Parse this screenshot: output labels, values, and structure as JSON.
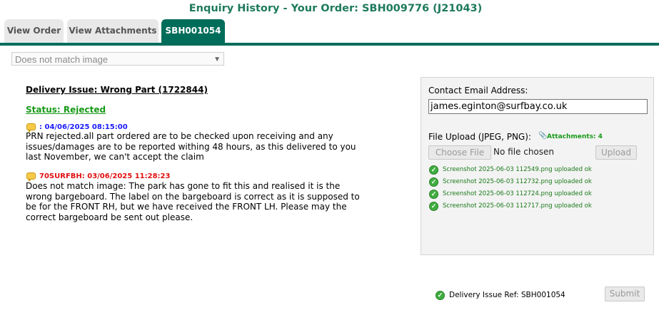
{
  "page": {
    "title": "Enquiry History - Your Order: SBH009776 (J21043)"
  },
  "tabs": [
    {
      "label": "View Order"
    },
    {
      "label": "View Attachments"
    },
    {
      "label": "SBH001054"
    }
  ],
  "reason_select": {
    "value": "Does not match image"
  },
  "issue": {
    "title": "Delivery Issue: Wrong Part (1722844)",
    "status": "Status: Rejected"
  },
  "messages": [
    {
      "header": ": 04/06/2025 08:15:00",
      "header_color": "#1a1aff",
      "body": "PRN rejected.all part ordered are to be checked upon receiving and any issues/damages are to be reported withing 48 hours, as this delivered to you last November, we can't accept the claim"
    },
    {
      "header": "70SURFBH: 03/06/2025 11:28:23",
      "header_color": "#e01010",
      "body": "Does not match image: The park has gone to fit this and realised it is the wrong bargeboard. The label on the bargeboard is correct as it is supposed to be for the FRONT RH, but we have received the FRONT LH. Please may the correct bargeboard be sent out please."
    }
  ],
  "contact": {
    "label": "Contact Email Address:",
    "email": "james.eginton@surfbay.co.uk"
  },
  "upload": {
    "label": "File Upload (JPEG, PNG):",
    "attachments": "Attachments: 4",
    "choose_label": "Choose File",
    "no_file": "No file chosen",
    "upload_label": "Upload",
    "uploaded": [
      "Screenshot 2025-06-03 112549.png uploaded ok",
      "Screenshot 2025-06-03 112732.png uploaded ok",
      "Screenshot 2025-06-03 112724.png uploaded ok",
      "Screenshot 2025-06-03 112717.png uploaded ok"
    ]
  },
  "footer": {
    "ref": "Delivery Issue Ref: SBH001054",
    "submit_label": "Submit"
  },
  "icons": {
    "message": "speech-bubble-icon",
    "attachment": "paperclip-icon",
    "status": "check-circle-icon"
  },
  "colors": {
    "brand": "#006d5b",
    "title": "#1e7a5e",
    "success": "#189a18"
  }
}
